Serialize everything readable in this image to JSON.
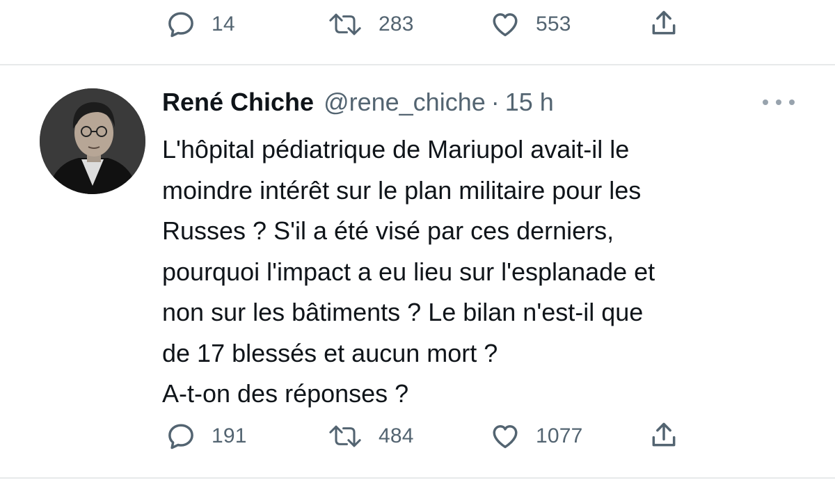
{
  "previous_tweet": {
    "actions": {
      "reply_count": "14",
      "retweet_count": "283",
      "like_count": "553"
    }
  },
  "tweet": {
    "author_name": "René Chiche",
    "handle": "@rene_chiche",
    "separator": "·",
    "time": "15 h",
    "text": "L'hôpital pédiatrique de Mariupol avait-il le\nmoindre intérêt sur le plan militaire pour les\nRusses ? S'il a été visé par ces derniers,\npourquoi l'impact a eu lieu sur l'esplanade et\nnon sur les bâtiments ? Le bilan n'est-il que\nde 17 blessés et aucun mort ?\nA-t-on des réponses ?",
    "actions": {
      "reply_count": "191",
      "retweet_count": "484",
      "like_count": "1077"
    }
  },
  "icons": {
    "reply": "speech-bubble-icon",
    "retweet": "retweet-arrows-icon",
    "like": "heart-outline-icon",
    "share": "share-upload-icon",
    "more": "more-horizontal-icon"
  },
  "colors": {
    "text_primary": "#0f1419",
    "text_secondary": "#536471",
    "divider": "#e7e9ea"
  }
}
